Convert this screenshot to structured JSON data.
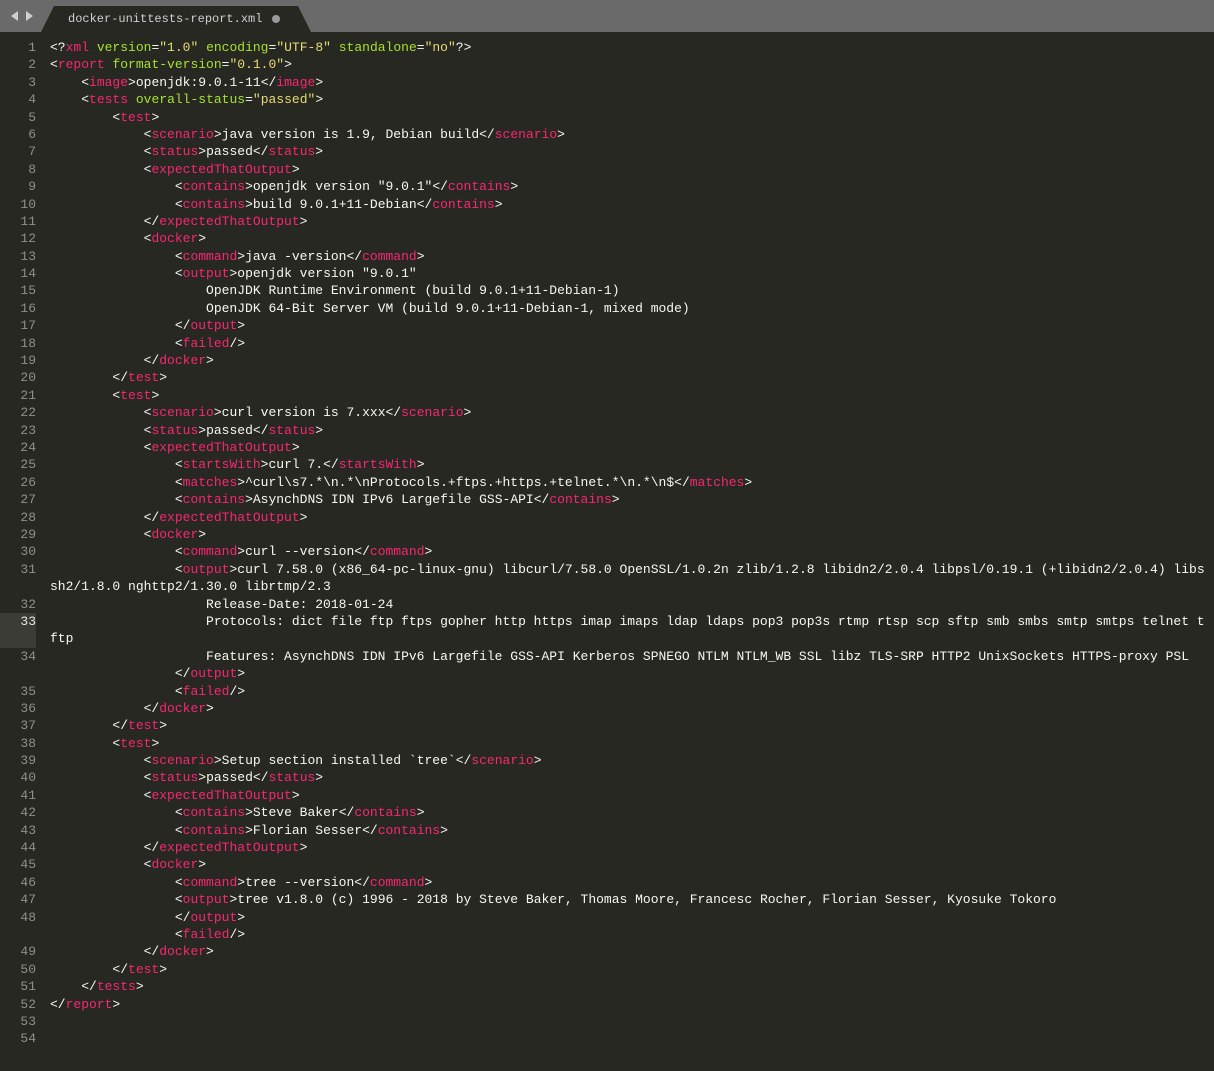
{
  "tab": {
    "title": "docker-unittests-report.xml",
    "dirty": true
  },
  "editor": {
    "line_count": 54,
    "current_line": 33,
    "wrapped_lines": [
      31,
      33,
      34,
      48
    ],
    "indent": "    "
  },
  "xml": {
    "declaration": {
      "attrs": [
        {
          "name": "version",
          "value": "1.0"
        },
        {
          "name": "encoding",
          "value": "UTF-8"
        },
        {
          "name": "standalone",
          "value": "no"
        }
      ]
    },
    "root": {
      "name": "report",
      "attrs": [
        {
          "name": "format-version",
          "value": "0.1.0"
        }
      ],
      "children": [
        {
          "name": "image",
          "text": "openjdk:9.0.1-11"
        },
        {
          "name": "tests",
          "attrs": [
            {
              "name": "overall-status",
              "value": "passed"
            }
          ],
          "children": [
            {
              "name": "test",
              "children": [
                {
                  "name": "scenario",
                  "text": "java version is 1.9, Debian build"
                },
                {
                  "name": "status",
                  "text": "passed"
                },
                {
                  "name": "expectedThatOutput",
                  "children": [
                    {
                      "name": "contains",
                      "text": "openjdk version \"9.0.1\""
                    },
                    {
                      "name": "contains",
                      "text": "build 9.0.1+11-Debian"
                    }
                  ]
                },
                {
                  "name": "docker",
                  "children": [
                    {
                      "name": "command",
                      "text": "java -version"
                    },
                    {
                      "name": "output",
                      "text_lines": [
                        "openjdk version \"9.0.1\"",
                        "OpenJDK Runtime Environment (build 9.0.1+11-Debian-1)",
                        "OpenJDK 64-Bit Server VM (build 9.0.1+11-Debian-1, mixed mode)"
                      ]
                    },
                    {
                      "name": "failed",
                      "self_closing": true
                    }
                  ]
                }
              ]
            },
            {
              "name": "test",
              "children": [
                {
                  "name": "scenario",
                  "text": "curl version is 7.xxx"
                },
                {
                  "name": "status",
                  "text": "passed"
                },
                {
                  "name": "expectedThatOutput",
                  "children": [
                    {
                      "name": "startsWith",
                      "text": "curl 7."
                    },
                    {
                      "name": "matches",
                      "text": "^curl\\s7.*\\n.*\\nProtocols.+ftps.+https.+telnet.*\\n.*\\n$"
                    },
                    {
                      "name": "contains",
                      "text": "AsynchDNS IDN IPv6 Largefile GSS-API"
                    }
                  ]
                },
                {
                  "name": "docker",
                  "children": [
                    {
                      "name": "command",
                      "text": "curl --version"
                    },
                    {
                      "name": "output",
                      "text_lines": [
                        "curl 7.58.0 (x86_64-pc-linux-gnu) libcurl/7.58.0 OpenSSL/1.0.2n zlib/1.2.8 libidn2/2.0.4 libpsl/0.19.1 (+libidn2/2.0.4) libssh2/1.8.0 nghttp2/1.30.0 librtmp/2.3",
                        "Release-Date: 2018-01-24",
                        "Protocols: dict file ftp ftps gopher http https imap imaps ldap ldaps pop3 pop3s rtmp rtsp scp sftp smb smbs smtp smtps telnet tftp",
                        "Features: AsynchDNS IDN IPv6 Largefile GSS-API Kerberos SPNEGO NTLM NTLM_WB SSL libz TLS-SRP HTTP2 UnixSockets HTTPS-proxy PSL"
                      ]
                    },
                    {
                      "name": "failed",
                      "self_closing": true
                    }
                  ]
                }
              ]
            },
            {
              "name": "test",
              "children": [
                {
                  "name": "scenario",
                  "text": "Setup section installed `tree`"
                },
                {
                  "name": "status",
                  "text": "passed"
                },
                {
                  "name": "expectedThatOutput",
                  "children": [
                    {
                      "name": "contains",
                      "text": "Steve Baker"
                    },
                    {
                      "name": "contains",
                      "text": "Florian Sesser"
                    }
                  ]
                },
                {
                  "name": "docker",
                  "children": [
                    {
                      "name": "command",
                      "text": "tree --version"
                    },
                    {
                      "name": "output",
                      "text_lines": [
                        "tree v1.8.0 (c) 1996 - 2018 by Steve Baker, Thomas Moore, Francesc Rocher, Florian Sesser, Kyosuke Tokoro"
                      ]
                    },
                    {
                      "name": "failed",
                      "self_closing": true
                    }
                  ]
                }
              ]
            }
          ]
        }
      ]
    }
  }
}
